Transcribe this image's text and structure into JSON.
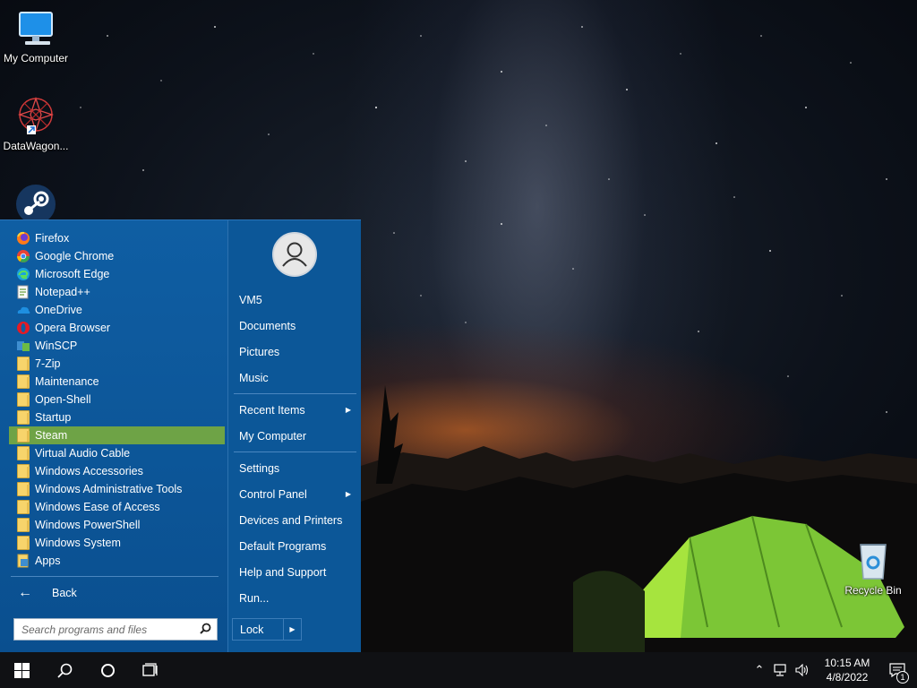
{
  "desktop": {
    "icons": [
      {
        "label": "My Computer"
      },
      {
        "label": "DataWagon..."
      },
      {
        "label": "Steam"
      },
      {
        "label": "Recycle Bin"
      }
    ]
  },
  "start_menu": {
    "programs": [
      {
        "label": "Firefox",
        "icon": "firefox-icon"
      },
      {
        "label": "Google Chrome",
        "icon": "chrome-icon"
      },
      {
        "label": "Microsoft Edge",
        "icon": "edge-icon"
      },
      {
        "label": "Notepad++",
        "icon": "notepadpp-icon"
      },
      {
        "label": "OneDrive",
        "icon": "onedrive-icon"
      },
      {
        "label": "Opera Browser",
        "icon": "opera-icon"
      },
      {
        "label": "WinSCP",
        "icon": "winscp-icon"
      },
      {
        "label": "7-Zip",
        "icon": "folder-icon"
      },
      {
        "label": "Maintenance",
        "icon": "folder-icon"
      },
      {
        "label": "Open-Shell",
        "icon": "folder-icon"
      },
      {
        "label": "Startup",
        "icon": "folder-icon"
      },
      {
        "label": "Steam",
        "icon": "folder-icon",
        "selected": true
      },
      {
        "label": "Virtual Audio Cable",
        "icon": "folder-icon"
      },
      {
        "label": "Windows Accessories",
        "icon": "folder-icon"
      },
      {
        "label": "Windows Administrative Tools",
        "icon": "folder-icon"
      },
      {
        "label": "Windows Ease of Access",
        "icon": "folder-icon"
      },
      {
        "label": "Windows PowerShell",
        "icon": "folder-icon"
      },
      {
        "label": "Windows System",
        "icon": "folder-icon"
      },
      {
        "label": "Apps",
        "icon": "apps-icon"
      }
    ],
    "back_label": "Back",
    "search_placeholder": "Search programs and files",
    "right_items": {
      "vm5": "VM5",
      "documents": "Documents",
      "pictures": "Pictures",
      "music": "Music",
      "recent_items": "Recent Items",
      "my_computer": "My Computer",
      "settings": "Settings",
      "control_panel": "Control Panel",
      "devices_printers": "Devices and Printers",
      "default_programs": "Default Programs",
      "help_support": "Help and Support",
      "run": "Run..."
    },
    "lock_label": "Lock",
    "colors": {
      "accent": "#0b5394",
      "selected": "#6ea346"
    }
  },
  "taskbar": {
    "time": "10:15 AM",
    "date": "4/8/2022",
    "notification_count": "1"
  }
}
